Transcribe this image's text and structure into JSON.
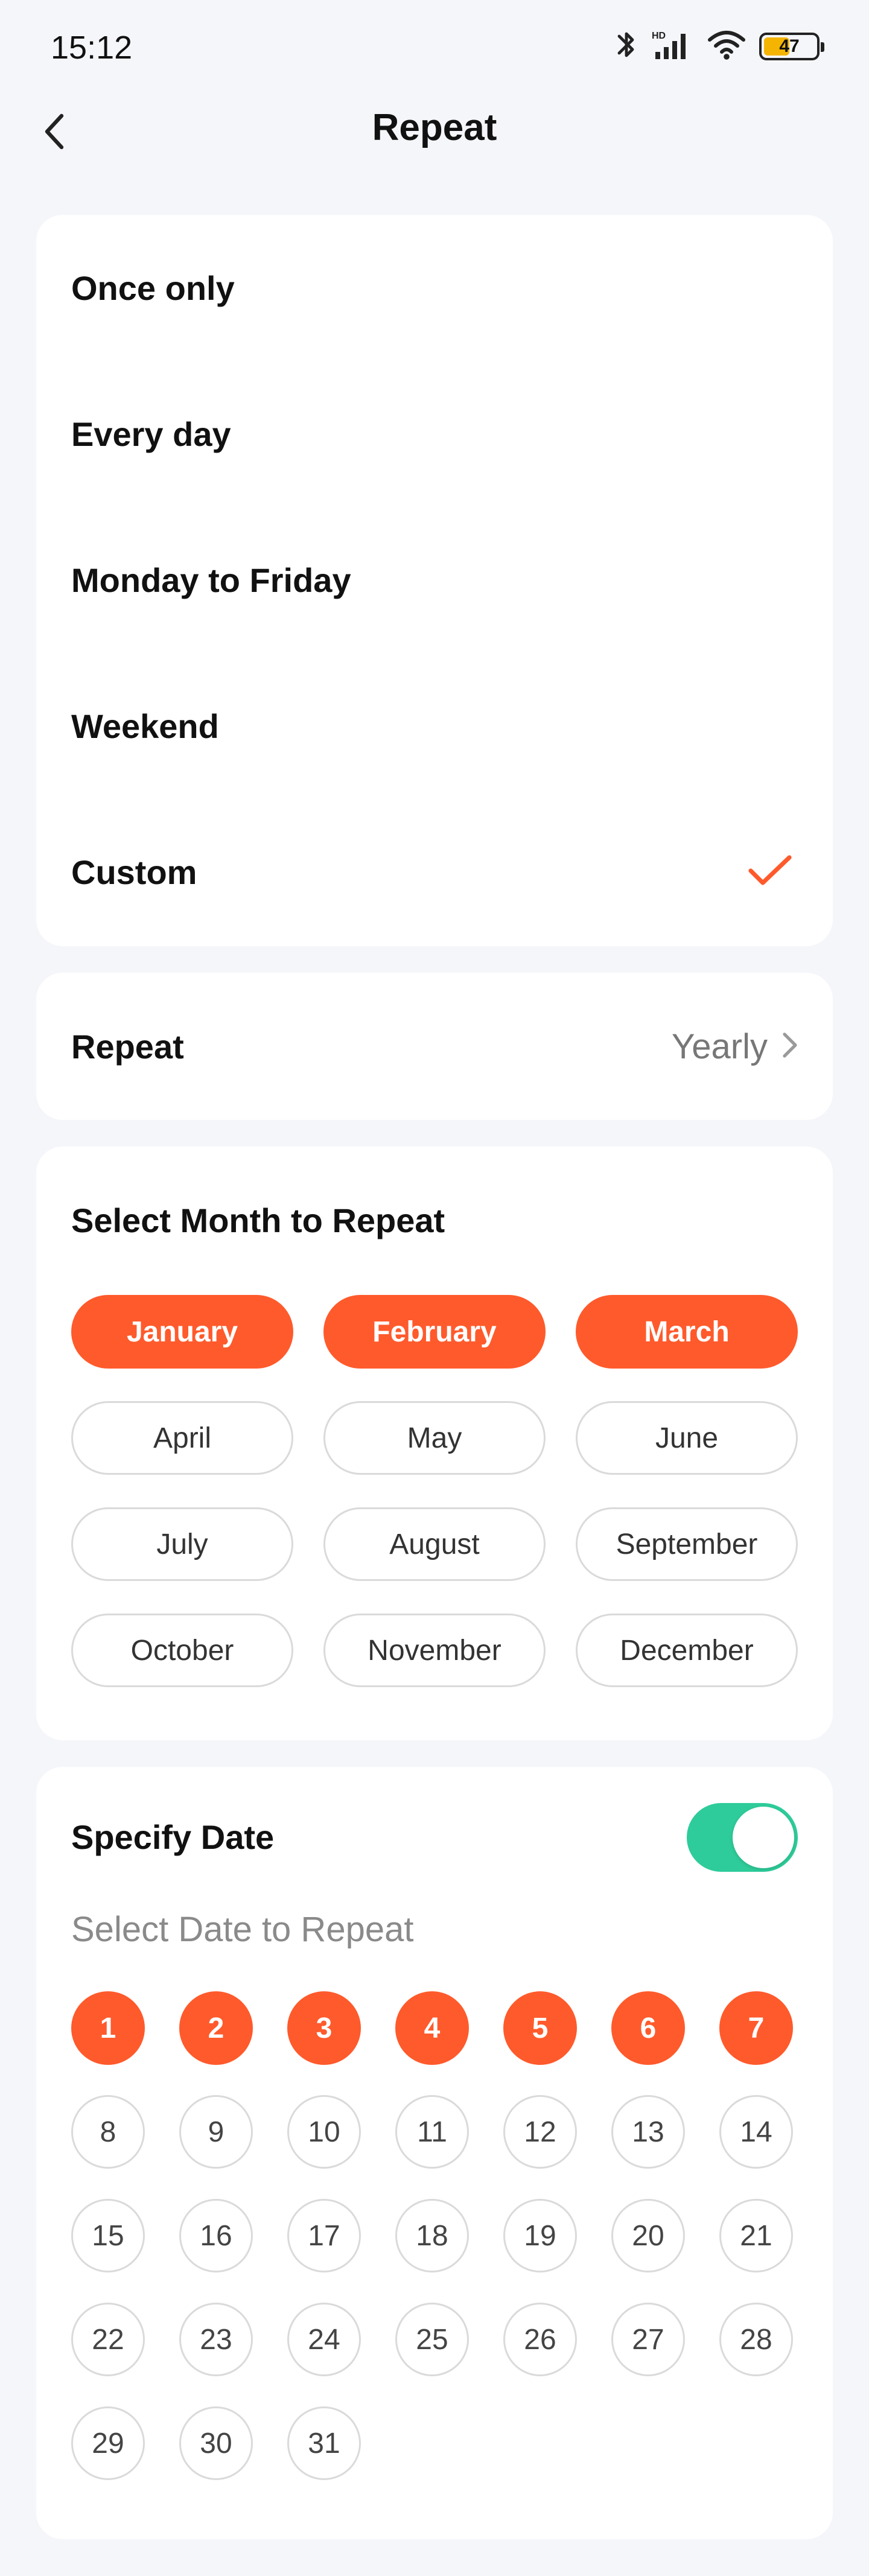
{
  "status_bar": {
    "time": "15:12",
    "battery": "47",
    "icons": [
      "bluetooth-icon",
      "hd-signal-icon",
      "wifi-icon",
      "battery-icon"
    ]
  },
  "header": {
    "title": "Repeat",
    "back_icon": "chevron-left-icon"
  },
  "options": [
    {
      "label": "Once only",
      "selected": false
    },
    {
      "label": "Every day",
      "selected": false
    },
    {
      "label": "Monday to Friday",
      "selected": false
    },
    {
      "label": "Weekend",
      "selected": false
    },
    {
      "label": "Custom",
      "selected": true
    }
  ],
  "repeat": {
    "label": "Repeat",
    "value": "Yearly"
  },
  "months_section": {
    "title": "Select Month to Repeat",
    "months": [
      {
        "label": "January",
        "selected": true
      },
      {
        "label": "February",
        "selected": true
      },
      {
        "label": "March",
        "selected": true
      },
      {
        "label": "April",
        "selected": false
      },
      {
        "label": "May",
        "selected": false
      },
      {
        "label": "June",
        "selected": false
      },
      {
        "label": "July",
        "selected": false
      },
      {
        "label": "August",
        "selected": false
      },
      {
        "label": "September",
        "selected": false
      },
      {
        "label": "October",
        "selected": false
      },
      {
        "label": "November",
        "selected": false
      },
      {
        "label": "December",
        "selected": false
      }
    ]
  },
  "dates_section": {
    "title": "Specify Date",
    "toggle_on": true,
    "subtitle": "Select Date to Repeat",
    "selected_dates": [
      1,
      2,
      3,
      4,
      5,
      6,
      7
    ],
    "dates": [
      "1",
      "2",
      "3",
      "4",
      "5",
      "6",
      "7",
      "8",
      "9",
      "10",
      "11",
      "12",
      "13",
      "14",
      "15",
      "16",
      "17",
      "18",
      "19",
      "20",
      "21",
      "22",
      "23",
      "24",
      "25",
      "26",
      "27",
      "28",
      "29",
      "30",
      "31"
    ]
  },
  "colors": {
    "accent": "#FF5A2C",
    "toggle_on": "#2ECC9A",
    "background": "#F5F6FA",
    "card": "#FFFFFF",
    "battery_fill": "#F4B400"
  }
}
